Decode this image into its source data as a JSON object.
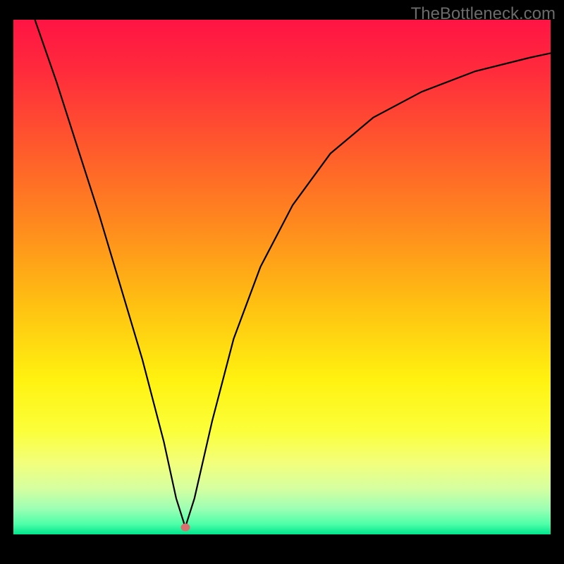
{
  "watermark": "TheBottleneck.com",
  "colors": {
    "gradient_stops": [
      {
        "offset": 0.0,
        "color": "#ff1444"
      },
      {
        "offset": 0.1,
        "color": "#ff2b3c"
      },
      {
        "offset": 0.25,
        "color": "#ff5a2c"
      },
      {
        "offset": 0.4,
        "color": "#ff8a1e"
      },
      {
        "offset": 0.55,
        "color": "#ffbf12"
      },
      {
        "offset": 0.7,
        "color": "#fff210"
      },
      {
        "offset": 0.8,
        "color": "#fbff3a"
      },
      {
        "offset": 0.86,
        "color": "#f3ff7a"
      },
      {
        "offset": 0.91,
        "color": "#d6ffa0"
      },
      {
        "offset": 0.95,
        "color": "#9cffb4"
      },
      {
        "offset": 0.98,
        "color": "#4effa8"
      },
      {
        "offset": 1.0,
        "color": "#00e58d"
      }
    ],
    "curve_stroke": "#000000",
    "marker_fill": "#d9706f",
    "background": "#000000"
  },
  "marker": {
    "x_frac": 0.32,
    "y_frac": 0.986
  },
  "chart_data": {
    "type": "line",
    "title": "",
    "xlabel": "",
    "ylabel": "",
    "xlim": [
      0,
      1
    ],
    "ylim": [
      0,
      1
    ],
    "series": [
      {
        "name": "curve",
        "x": [
          0.04,
          0.08,
          0.12,
          0.16,
          0.2,
          0.24,
          0.28,
          0.303,
          0.32,
          0.337,
          0.37,
          0.41,
          0.46,
          0.52,
          0.59,
          0.67,
          0.76,
          0.86,
          0.96,
          1.0
        ],
        "y": [
          1.0,
          0.88,
          0.75,
          0.62,
          0.48,
          0.34,
          0.18,
          0.07,
          0.014,
          0.07,
          0.22,
          0.38,
          0.52,
          0.64,
          0.74,
          0.81,
          0.86,
          0.9,
          0.926,
          0.935
        ]
      }
    ],
    "annotations": [
      {
        "type": "point",
        "x": 0.32,
        "y": 0.014,
        "label": "marker"
      }
    ]
  }
}
